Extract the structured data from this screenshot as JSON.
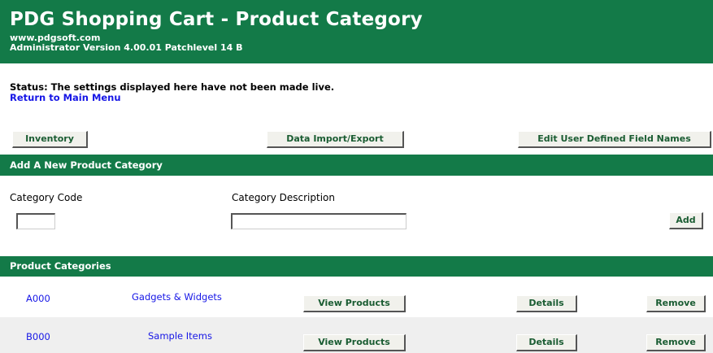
{
  "header": {
    "title": "PDG Shopping Cart - Product Category",
    "site": "www.pdgsoft.com",
    "version": "Administrator Version 4.00.01 Patchlevel 14 B"
  },
  "status": {
    "text": "Status: The settings displayed here have not been made live.",
    "return_link": "Return to Main Menu"
  },
  "nav_buttons": {
    "inventory": "Inventory",
    "data_import_export": "Data Import/Export",
    "edit_fields": "Edit User Defined Field Names"
  },
  "add_section": {
    "heading": "Add A New Product Category",
    "code_label": "Category Code",
    "code_value": "",
    "description_label": "Category Description",
    "description_value": "",
    "add_button": "Add"
  },
  "categories_section": {
    "heading": "Product Categories",
    "rows": [
      {
        "code": "A000",
        "description": "Gadgets & Widgets",
        "view": "View Products",
        "details": "Details",
        "remove": "Remove"
      },
      {
        "code": "B000",
        "description": "Sample Items",
        "view": "View Products",
        "details": "Details",
        "remove": "Remove"
      }
    ]
  },
  "colors": {
    "header_green": "#137a48",
    "link_blue": "#1616e6",
    "button_text": "#1a5c32"
  }
}
